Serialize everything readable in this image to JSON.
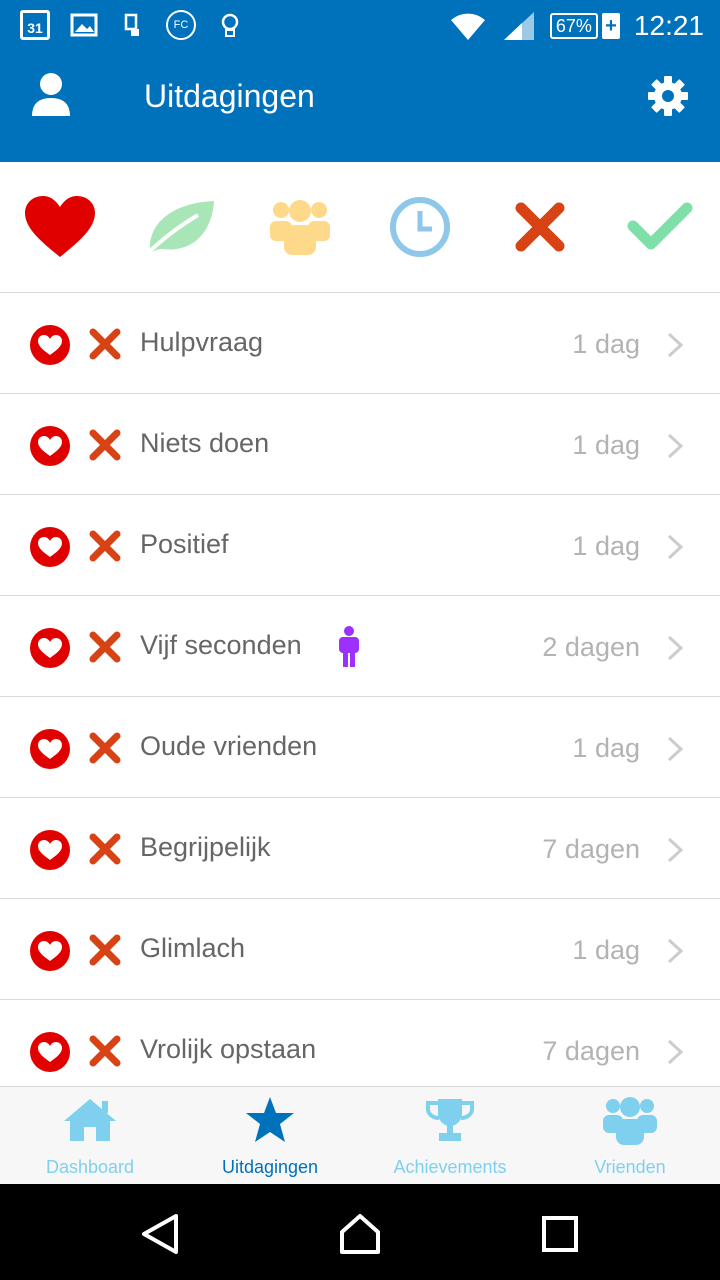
{
  "status_bar": {
    "calendar_day": "31",
    "icons": [
      "calendar-icon",
      "image-icon",
      "sim-icon",
      "fc-icon",
      "lightbulb-icon",
      "wifi-icon",
      "signal-icon"
    ],
    "fc_text": "FC",
    "battery": "67%",
    "battery_plus": "+",
    "time": "12:21"
  },
  "app_bar": {
    "title": "Uitdagingen",
    "left_icon": "profile-icon",
    "right_icon": "settings-icon",
    "color": "#0072bc"
  },
  "filters": [
    {
      "icon": "heart-icon",
      "color": "#e00000"
    },
    {
      "icon": "leaf-icon",
      "color": "#a8e6b8"
    },
    {
      "icon": "group-icon",
      "color": "#ffd98a"
    },
    {
      "icon": "clock-icon",
      "color": "#8ec7ea"
    },
    {
      "icon": "x-icon",
      "color": "#d84315"
    },
    {
      "icon": "check-icon",
      "color": "#7ee0a8"
    }
  ],
  "challenges": [
    {
      "title": "Hulpvraag",
      "duration": "1 dag",
      "solo": false
    },
    {
      "title": "Niets doen",
      "duration": "1 dag",
      "solo": false
    },
    {
      "title": "Positief",
      "duration": "1 dag",
      "solo": false
    },
    {
      "title": "Vijf seconden",
      "duration": "2 dagen",
      "solo": true
    },
    {
      "title": "Oude vrienden",
      "duration": "1 dag",
      "solo": false
    },
    {
      "title": "Begrijpelijk",
      "duration": "7 dagen",
      "solo": false
    },
    {
      "title": "Glimlach",
      "duration": "1 dag",
      "solo": false
    },
    {
      "title": "Vrolijk opstaan",
      "duration": "7 dagen",
      "solo": false
    }
  ],
  "tabs": [
    {
      "label": "Dashboard",
      "icon": "home-icon",
      "active": false
    },
    {
      "label": "Uitdagingen",
      "icon": "star-icon",
      "active": true
    },
    {
      "label": "Achievements",
      "icon": "trophy-icon",
      "active": false
    },
    {
      "label": "Vrienden",
      "icon": "friends-icon",
      "active": false
    }
  ],
  "nav_bar": [
    "back-icon",
    "home-icon",
    "recents-icon"
  ]
}
